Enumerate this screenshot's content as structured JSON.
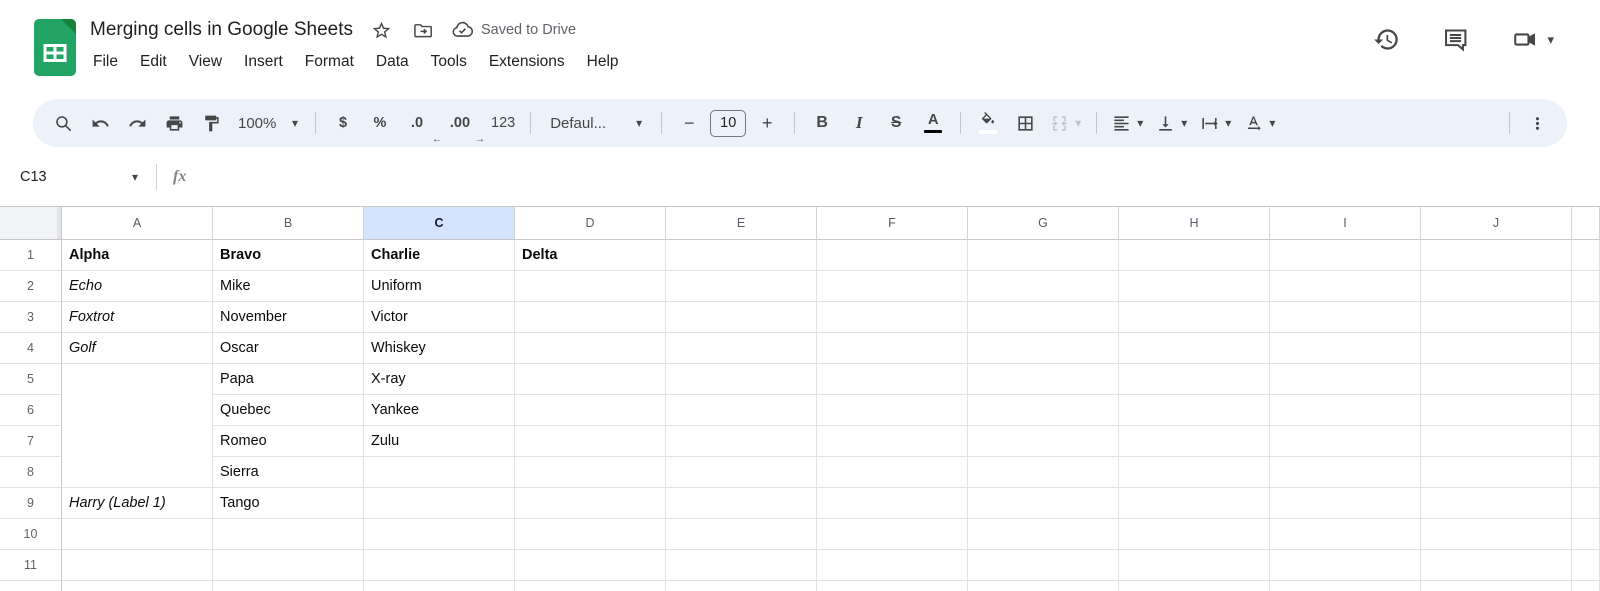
{
  "titlebar": {
    "title": "Merging cells in Google Sheets",
    "saved_status": "Saved to Drive",
    "menus": [
      "File",
      "Edit",
      "View",
      "Insert",
      "Format",
      "Data",
      "Tools",
      "Extensions",
      "Help"
    ]
  },
  "toolbar": {
    "zoom_value": "100%",
    "currency": "$",
    "percent": "%",
    "decrease_decimals": ".0",
    "increase_decimals": ".00",
    "number_format": "123",
    "font_name": "Defaul...",
    "minus": "−",
    "font_size": "10",
    "plus": "+",
    "bold": "B",
    "italic": "I",
    "strikethrough": "S",
    "text_color": "A",
    "more": "⋮"
  },
  "formula_bar": {
    "name_box": "C13",
    "fx_label": "fx",
    "formula": ""
  },
  "grid": {
    "column_headers": [
      "A",
      "B",
      "C",
      "D",
      "E",
      "F",
      "G",
      "H",
      "I",
      "J"
    ],
    "selected_column": "C",
    "active_cell": "C13",
    "merged_range": "A5:A8",
    "bold_rows": [
      1
    ],
    "italic_cells": [
      "A2",
      "A3",
      "A4",
      "A9"
    ],
    "rows": [
      {
        "num": "1",
        "A": "Alpha",
        "B": "Bravo",
        "C": "Charlie",
        "D": "Delta"
      },
      {
        "num": "2",
        "A": "Echo",
        "B": "Mike",
        "C": "Uniform",
        "D": ""
      },
      {
        "num": "3",
        "A": "Foxtrot",
        "B": "November",
        "C": "Victor",
        "D": ""
      },
      {
        "num": "4",
        "A": "Golf",
        "B": "Oscar",
        "C": "Whiskey",
        "D": ""
      },
      {
        "num": "5",
        "A": "",
        "B": "Papa",
        "C": "X-ray",
        "D": ""
      },
      {
        "num": "6",
        "A": "",
        "B": "Quebec",
        "C": "Yankee",
        "D": ""
      },
      {
        "num": "7",
        "A": "",
        "B": "Romeo",
        "C": "Zulu",
        "D": ""
      },
      {
        "num": "8",
        "A": "",
        "B": "Sierra",
        "C": "",
        "D": ""
      },
      {
        "num": "9",
        "A": "Harry (Label 1)",
        "B": "Tango",
        "C": "",
        "D": ""
      },
      {
        "num": "10",
        "A": "",
        "B": "",
        "C": "",
        "D": ""
      },
      {
        "num": "11",
        "A": "",
        "B": "",
        "C": "",
        "D": ""
      }
    ]
  },
  "colors": {
    "selected_header_bg": "#d3e3fd",
    "toolbar_bg": "#edf2fa",
    "sheets_green": "#21a464",
    "sheets_green_dark": "#188038",
    "icon_color": "#444746",
    "muted_text": "#5f6368",
    "text_color_swatch": "#000000",
    "fill_color_swatch": "#ffffff",
    "gridline": "#e2e2e2"
  }
}
